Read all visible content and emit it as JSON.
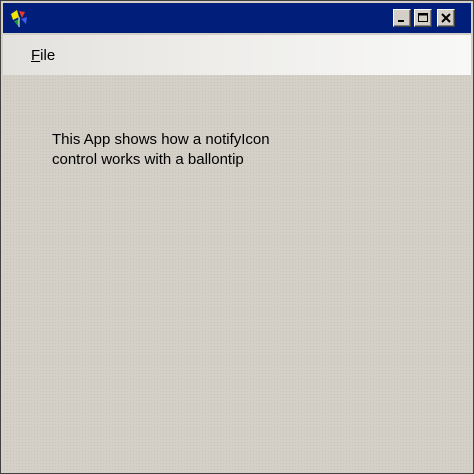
{
  "window": {
    "title": "",
    "controls": {
      "minimize_icon": "minimize-icon",
      "maximize_icon": "maximize-icon",
      "close_icon": "close-icon"
    },
    "colors": {
      "titlebar": "#001e7a",
      "face": "#d4d0c8"
    }
  },
  "menubar": {
    "items": [
      {
        "label": "File",
        "mnemonic": "F",
        "rest": "ile"
      }
    ]
  },
  "content": {
    "description": "This App shows how a notifyIcon control works with a ballontip"
  }
}
